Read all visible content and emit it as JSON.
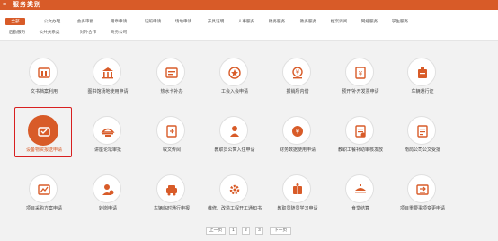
{
  "header": {
    "title": "服务类别"
  },
  "categories": [
    "全部",
    "公文办理",
    "会务审批",
    "用章申请",
    "证照申请",
    "场地申请",
    "开具证明",
    "人事服务",
    "财务服务",
    "教务服务",
    "档案调阅",
    "网络服务",
    "学生服务",
    "后勤服务",
    "公共关系类",
    "对外合作",
    "商务公司"
  ],
  "active_category": "全部",
  "tiles": [
    {
      "label": "文书档案利用",
      "icon": "archive-icon"
    },
    {
      "label": "图书馆场地使用申请",
      "icon": "library-icon"
    },
    {
      "label": "热水卡补办",
      "icon": "card-icon"
    },
    {
      "label": "工会入会申请",
      "icon": "union-icon"
    },
    {
      "label": "报销所内借",
      "icon": "reimburse-icon"
    },
    {
      "label": "预开/补开发票申请",
      "icon": "invoice-icon"
    },
    {
      "label": "车辆通行证",
      "icon": "pass-icon"
    },
    {
      "label": "设备物资报送申请",
      "icon": "equipment-icon",
      "selected": true
    },
    {
      "label": "讲座论坛审批",
      "icon": "lecture-icon"
    },
    {
      "label": "收文传阅",
      "icon": "document-icon"
    },
    {
      "label": "教职员公寓入住申请",
      "icon": "apartment-icon"
    },
    {
      "label": "财务数据使用申请",
      "icon": "finance-data-icon"
    },
    {
      "label": "教职工餐补助审核发放",
      "icon": "meal-icon"
    },
    {
      "label": "南局公司公文受批",
      "icon": "company-doc-icon"
    },
    {
      "label": "项目采购方案申请",
      "icon": "purchase-icon"
    },
    {
      "label": "转岗申请",
      "icon": "transfer-icon"
    },
    {
      "label": "车辆临时通行申报",
      "icon": "vehicle-icon"
    },
    {
      "label": "维修、改造工程开工通知书",
      "icon": "repair-icon"
    },
    {
      "label": "教职员随员学习申请",
      "icon": "study-icon"
    },
    {
      "label": "食堂结算",
      "icon": "canteen-icon"
    },
    {
      "label": "项目重要事项变更申请",
      "icon": "project-change-icon"
    }
  ],
  "pagination": {
    "prev": "上一页",
    "pages": [
      "1",
      "2",
      "3"
    ],
    "current": "1",
    "next": "下一页"
  },
  "colors": {
    "accent": "#d85b28",
    "icon": "#d85b28",
    "highlight_border": "#d82020"
  }
}
